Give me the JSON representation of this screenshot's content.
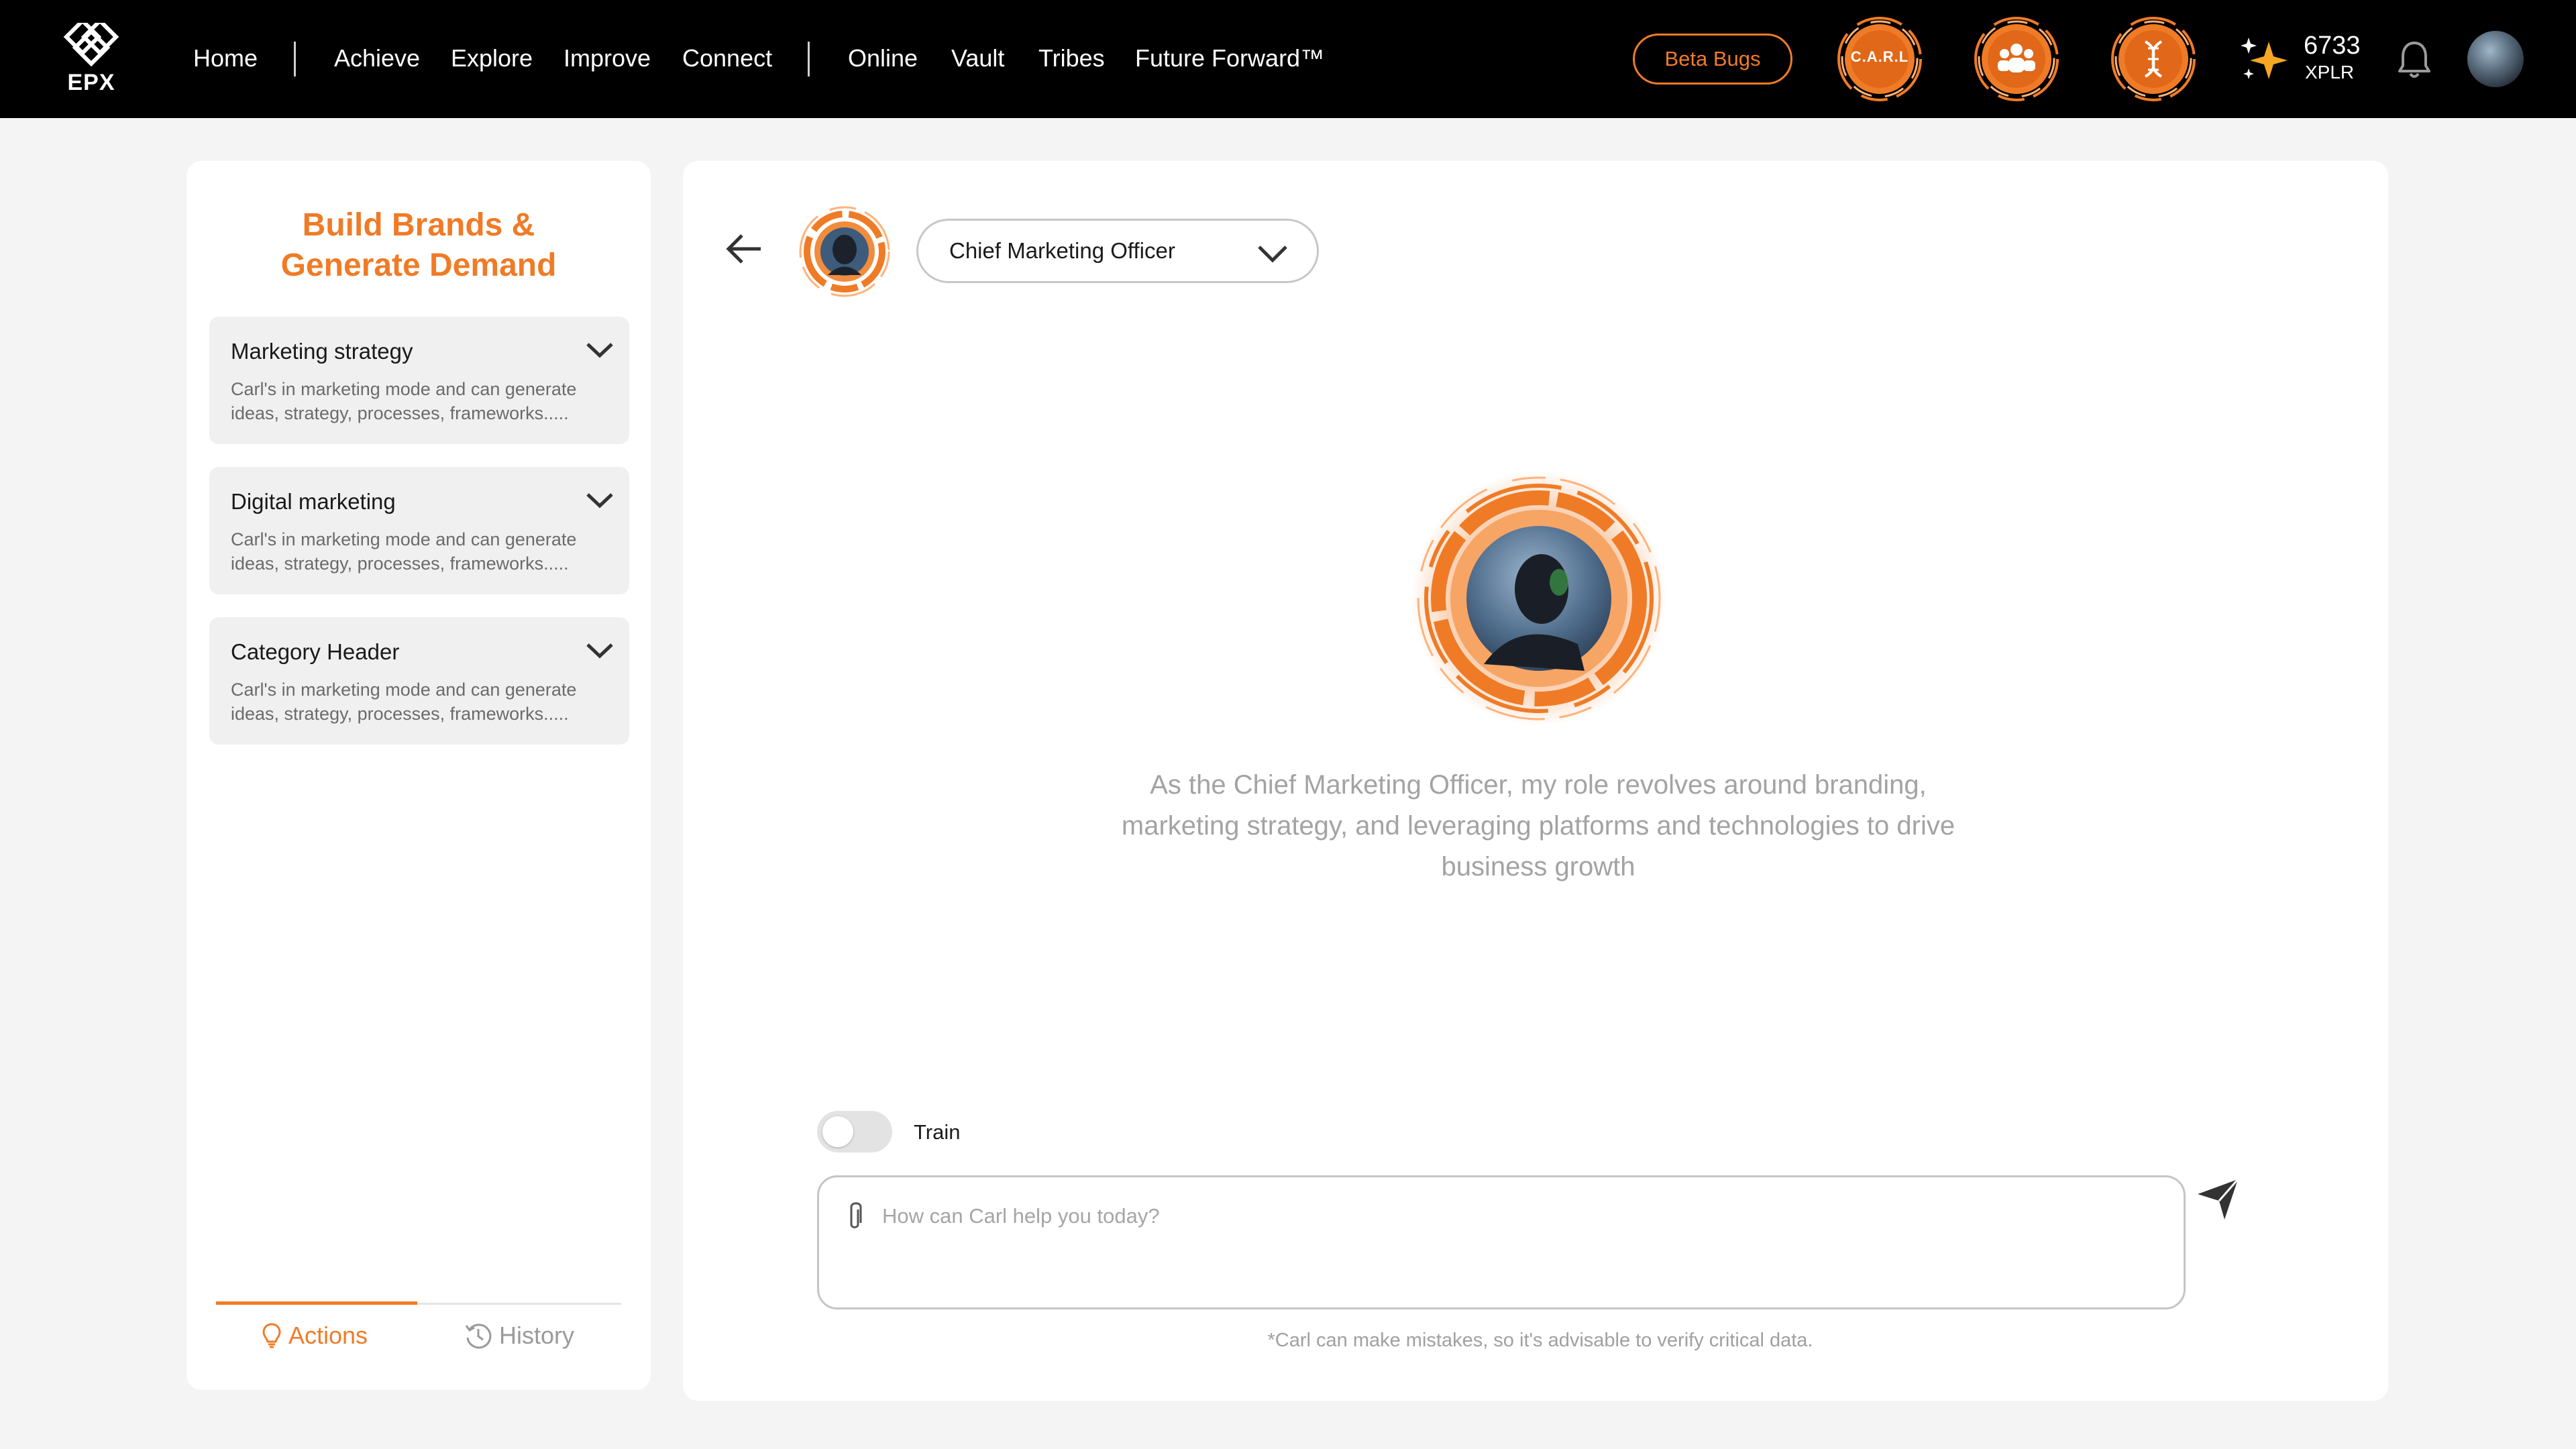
{
  "brand": {
    "logo_text": "EPX"
  },
  "nav": {
    "items": [
      "Home",
      "Achieve",
      "Explore",
      "Improve",
      "Connect",
      "Online",
      "Vault",
      "Tribes",
      "Future Forward™"
    ]
  },
  "header": {
    "beta_label": "Beta Bugs",
    "badges": [
      {
        "name": "carl-badge",
        "label": "C.A.R.L"
      },
      {
        "name": "team-badge",
        "label": ""
      },
      {
        "name": "dna-badge",
        "label": ""
      }
    ],
    "xplr_value": "6733",
    "xplr_unit": "XPLR"
  },
  "sidebar": {
    "title_line1": "Build Brands &",
    "title_line2": "Generate Demand",
    "cards": [
      {
        "title": "Marketing strategy",
        "desc": "Carl's in marketing mode and can generate ideas, strategy, processes, frameworks....."
      },
      {
        "title": "Digital marketing",
        "desc": "Carl's in marketing mode and can generate ideas, strategy, processes, frameworks....."
      },
      {
        "title": "Category Header",
        "desc": "Carl's in marketing mode and can generate ideas, strategy, processes, frameworks....."
      }
    ],
    "tabs": {
      "actions": "Actions",
      "history": "History",
      "active": "actions"
    }
  },
  "main": {
    "role_selected": "Chief Marketing Officer",
    "intro": "As the Chief Marketing Officer, my role revolves around branding, marketing strategy, and leveraging platforms and technologies to drive business growth",
    "train_label": "Train",
    "train_on": false,
    "chat_placeholder": "How can Carl help you today?",
    "disclaimer": "*Carl can make mistakes, so it's advisable to verify critical data."
  },
  "colors": {
    "accent": "#f07b26",
    "topbar": "#000000",
    "background": "#f4f4f4"
  },
  "icons": [
    "epx-logo-icon",
    "sparkle-icon",
    "bell-icon",
    "back-arrow-icon",
    "chevron-down-icon",
    "lightbulb-icon",
    "history-icon",
    "paperclip-icon",
    "send-icon",
    "people-icon",
    "dna-icon"
  ]
}
